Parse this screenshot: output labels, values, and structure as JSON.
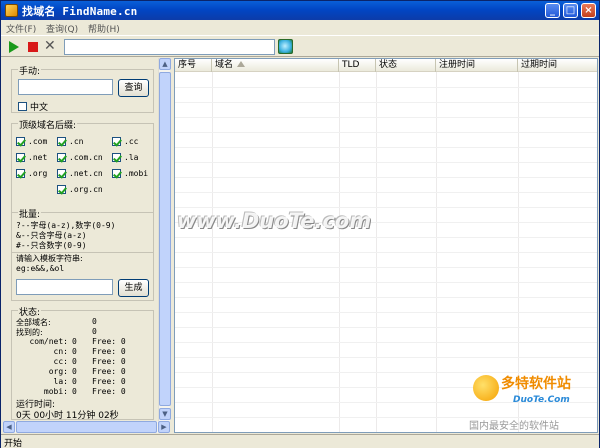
{
  "window": {
    "title": "找域名 FindName.cn",
    "controls": {
      "minimize": "_",
      "maximize": "□",
      "close": "×"
    }
  },
  "menu": [
    "文件(F)",
    "查询(Q)",
    "帮助(H)"
  ],
  "toolbar": {
    "url_value": "",
    "icons": [
      "play-icon",
      "stop-icon",
      "cancel-icon",
      "go-icon"
    ]
  },
  "manual": {
    "label": "手动:",
    "input_value": "",
    "query_button": "查询",
    "chinese_label": "中文",
    "chinese_checked": false
  },
  "tld": {
    "label": "顶级域名后缀:",
    "items": [
      {
        "label": ".com",
        "checked": true
      },
      {
        "label": ".cn",
        "checked": true
      },
      {
        "label": ".cc",
        "checked": true
      },
      {
        "label": ".net",
        "checked": true
      },
      {
        "label": ".com.cn",
        "checked": true
      },
      {
        "label": ".la",
        "checked": true
      },
      {
        "label": ".org",
        "checked": true
      },
      {
        "label": ".net.cn",
        "checked": true
      },
      {
        "label": ".mobi",
        "checked": true
      },
      {
        "label": ".org.cn",
        "checked": true
      }
    ]
  },
  "bulk": {
    "label": "批量:",
    "rules": [
      "?--字母(a-z),数字(0-9)",
      "&--只含字母(a-z)",
      "#--只含数字(0-9)"
    ],
    "template_prompt": "请输入模板字符串:",
    "example": "eg:e&&,&ol",
    "input_value": "",
    "generate_button": "生成"
  },
  "status": {
    "label": "状态:",
    "lines": [
      {
        "key": "全部域名:",
        "value": "0",
        "free": ""
      },
      {
        "key": "找到的:",
        "value": "0",
        "free": ""
      },
      {
        "key": "com/net:",
        "value": "0",
        "free": "Free: 0"
      },
      {
        "key": "cn:",
        "value": "0",
        "free": "Free: 0"
      },
      {
        "key": "cc:",
        "value": "0",
        "free": "Free: 0"
      },
      {
        "key": "org:",
        "value": "0",
        "free": "Free: 0"
      },
      {
        "key": "la:",
        "value": "0",
        "free": "Free: 0"
      },
      {
        "key": "mobi:",
        "value": "0",
        "free": "Free: 0"
      }
    ],
    "runtime_label": "运行时间:",
    "runtime_value": "0天 00小时 11分钟 02秒"
  },
  "table": {
    "columns": [
      "序号",
      "域名",
      "TLD",
      "状态",
      "注册时间",
      "过期时间"
    ],
    "rows": []
  },
  "statusbar": {
    "text": "开始"
  },
  "watermark": {
    "center": "www.DuoTe.com",
    "logo_cn": "多特软件站",
    "logo_en": "DuoTe.Com",
    "slogan": "国内最安全的软件站"
  }
}
